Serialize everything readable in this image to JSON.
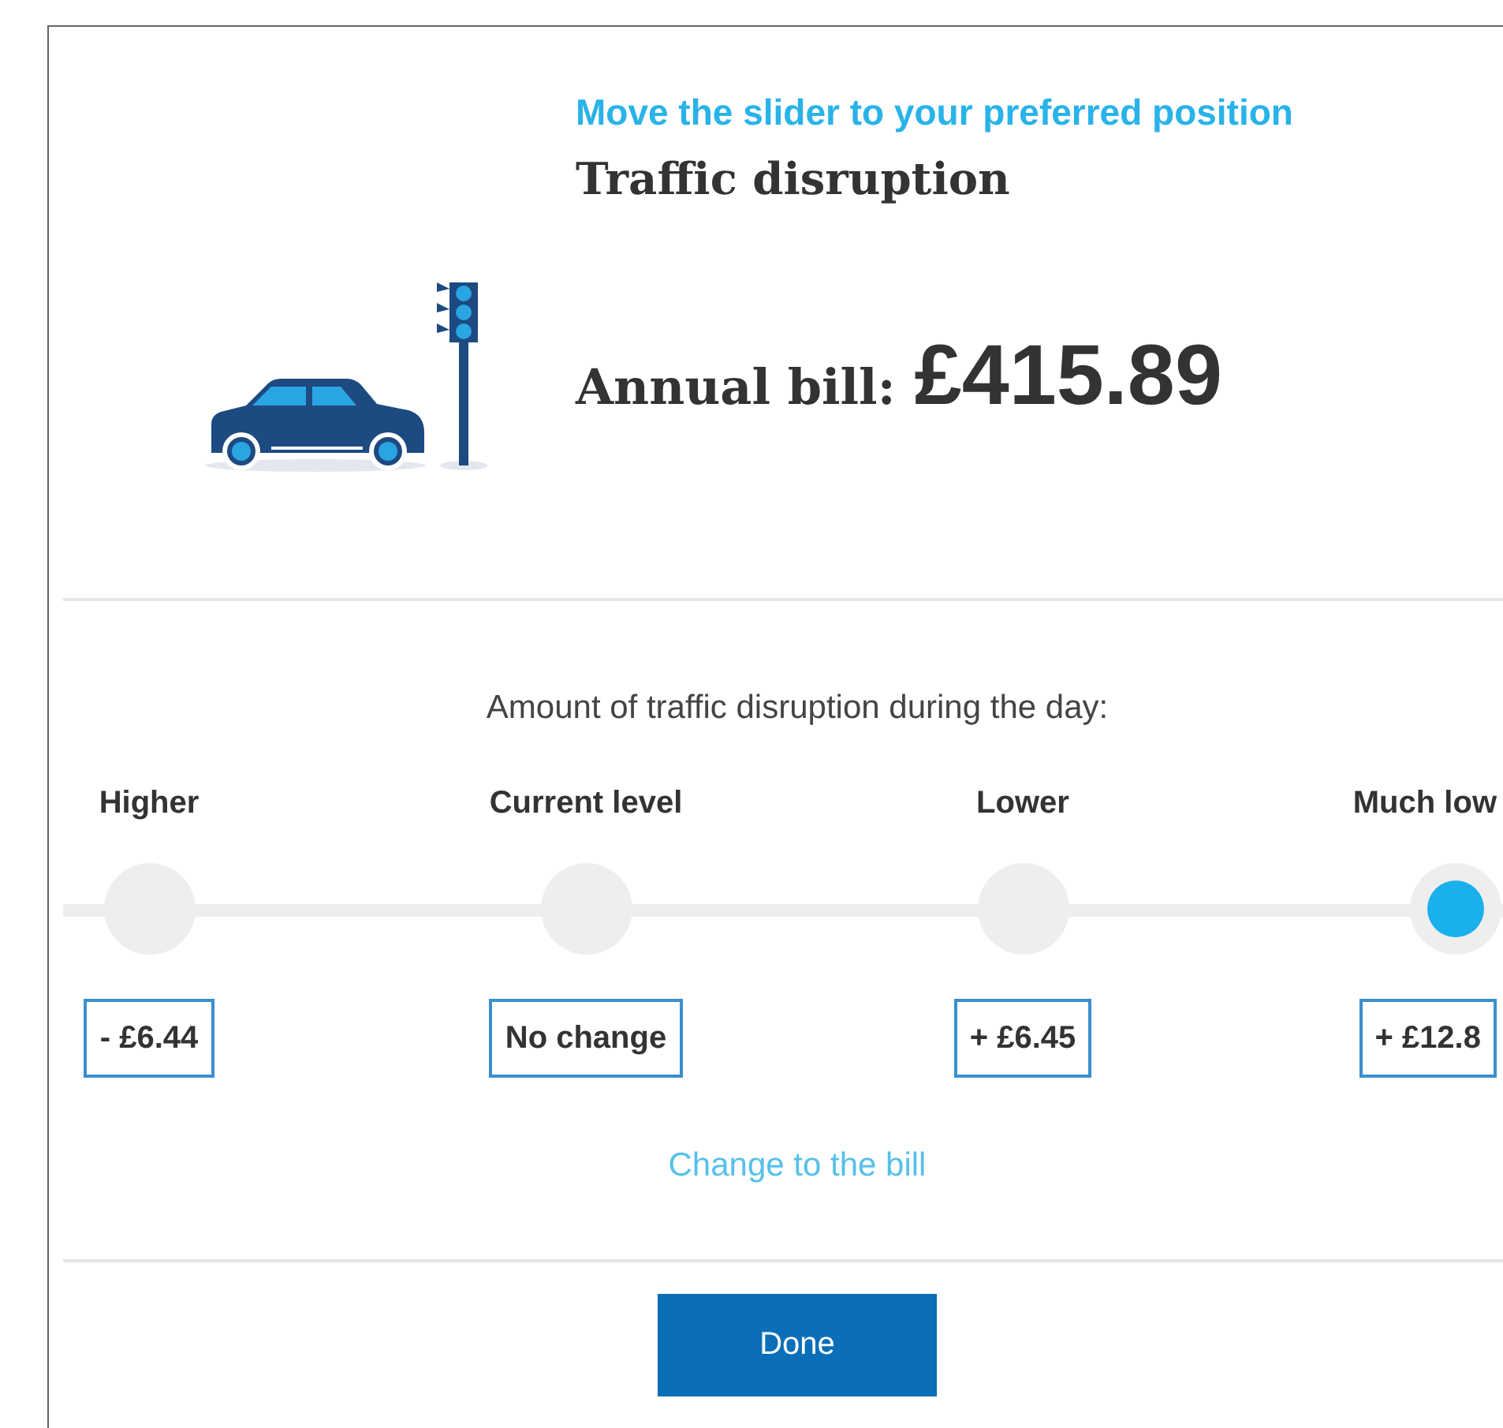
{
  "header": {
    "instruction": "Move the slider to your preferred position",
    "title": "Traffic disruption"
  },
  "bill": {
    "label": "Annual bill:",
    "amount": "£415.89"
  },
  "slider": {
    "prompt": "Amount of traffic disruption during the day:",
    "options": [
      {
        "label": "Higher",
        "change": "- £6.44",
        "selected": false
      },
      {
        "label": "Current level",
        "change": "No change",
        "selected": false
      },
      {
        "label": "Lower",
        "change": "+ £6.45",
        "selected": false
      },
      {
        "label": "Much low",
        "change": "+ £12.8",
        "selected": true
      }
    ],
    "caption": "Change to the bill"
  },
  "done_button": "Done"
}
